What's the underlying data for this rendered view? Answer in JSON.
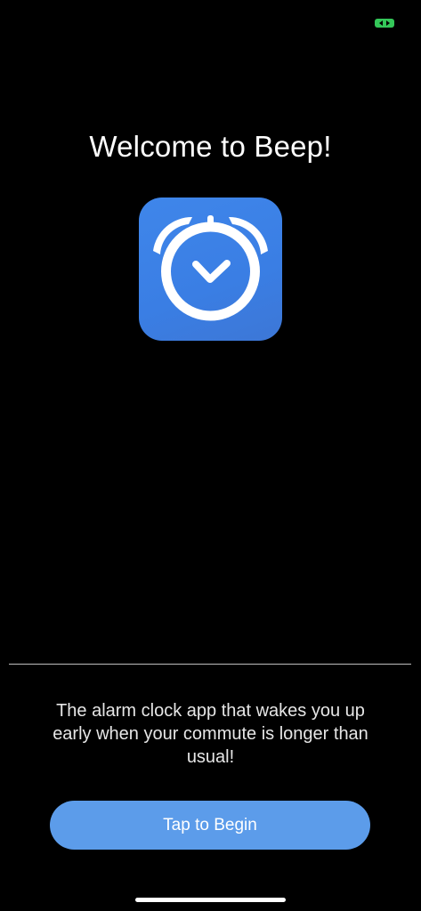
{
  "status_bar": {
    "indicator_icon": "screen-recording-indicator-icon",
    "indicator_color": "#34c759"
  },
  "welcome": {
    "title": "Welcome to Beep!"
  },
  "app_icon": {
    "icon": "alarm-clock-icon",
    "background_color": "#3f86ea"
  },
  "footer": {
    "tagline": "The alarm clock app that wakes you up early when your commute is longer than usual!",
    "cta_label": "Tap to Begin",
    "cta_color": "#5c9cea"
  }
}
